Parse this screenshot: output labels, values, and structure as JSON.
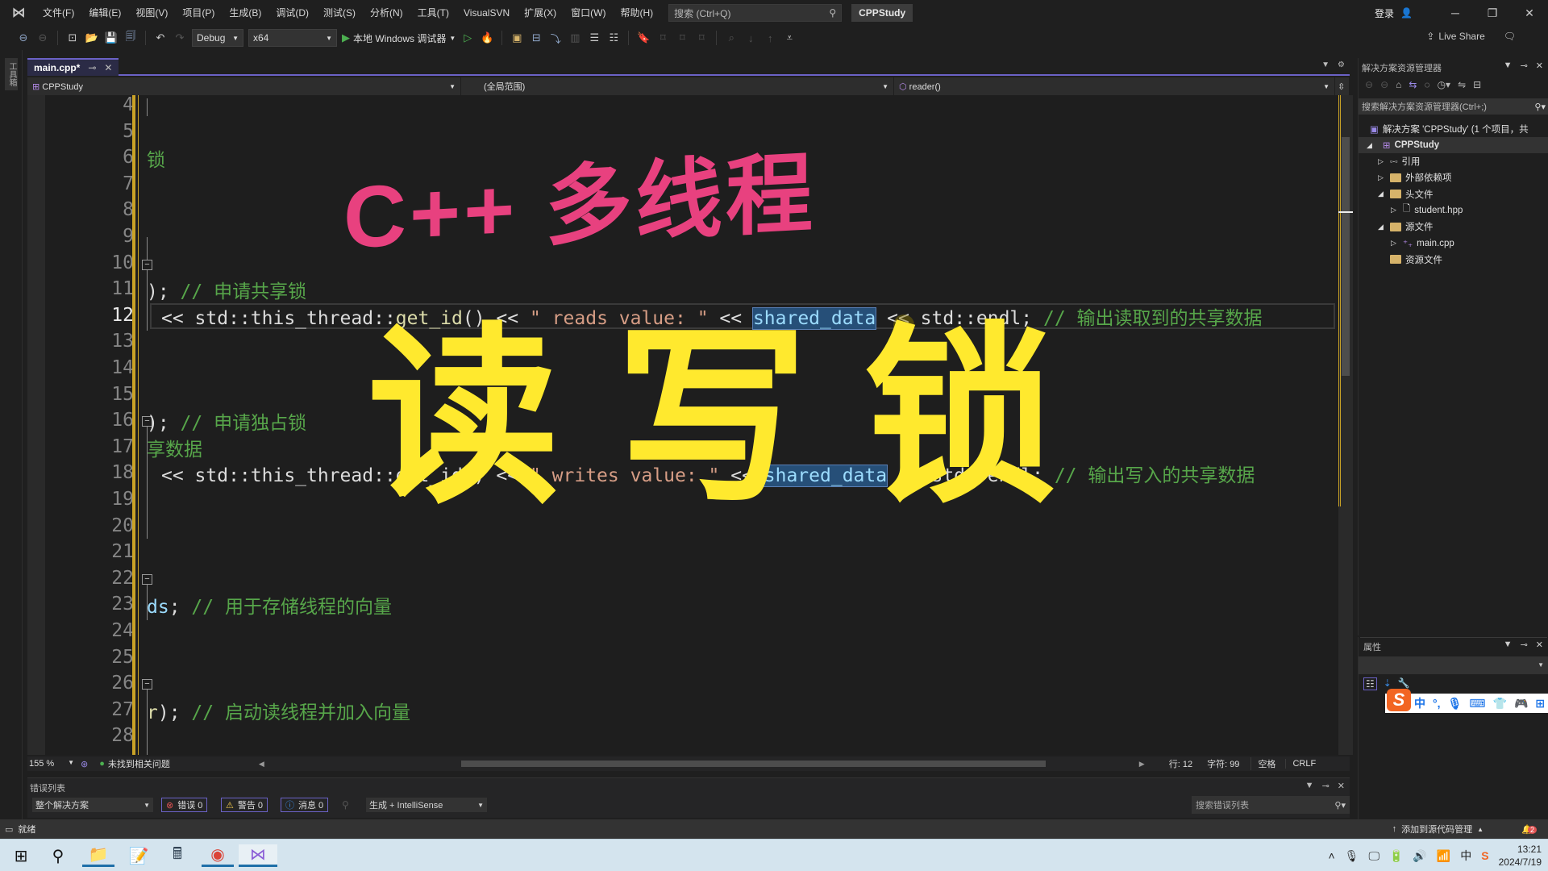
{
  "menubar": {
    "items": [
      "文件(F)",
      "编辑(E)",
      "视图(V)",
      "项目(P)",
      "生成(B)",
      "调试(D)",
      "测试(S)",
      "分析(N)",
      "工具(T)",
      "VisualSVN",
      "扩展(X)",
      "窗口(W)",
      "帮助(H)"
    ],
    "search_placeholder": "搜索 (Ctrl+Q)",
    "solution_name": "CPPStudy",
    "login": "登录"
  },
  "toolbar": {
    "config": "Debug",
    "platform": "x64",
    "run_label": "本地 Windows 调试器",
    "live_share": "Live Share"
  },
  "toolbox": {
    "label": "工具箱"
  },
  "editor": {
    "tab_label": "main.cpp*",
    "nav_project": "CPPStudy",
    "nav_scope": "(全局范围)",
    "nav_member": "reader()",
    "current_line": 12,
    "line_numbers": [
      4,
      5,
      6,
      7,
      8,
      9,
      10,
      11,
      12,
      13,
      14,
      15,
      16,
      17,
      18,
      19,
      20,
      21,
      22,
      23,
      24,
      25,
      26,
      27,
      28
    ],
    "code": {
      "l6": "锁",
      "l11_code": "); ",
      "l11_comment": "// 申请共享锁",
      "l12_a": "<< std::this_thread::",
      "l12_fn": "get_id",
      "l12_b": "() << ",
      "l12_str": "\" reads value: \"",
      "l12_c": " << ",
      "l12_sel": "shared_data",
      "l12_d": " << std::endl; ",
      "l12_comment": "// 输出读取到的共享数据",
      "l17_code": "); ",
      "l17_comment": "// 申请独占锁",
      "l18_comment": "享数据",
      "l19_a": "<< std::this_thread::get_id() << ",
      "l19_str": "\" writes value: \"",
      "l19_b": " << ",
      "l19_sel": "shared_data",
      "l19_c": " << std::endl; ",
      "l19_comment": "// 输出写入的共享数据",
      "l23_var": "ds",
      "l23_code": "; ",
      "l23_comment": "// 用于存储线程的向量",
      "l27_var": "r",
      "l27_code": "); ",
      "l27_comment": "// 启动读线程并加入向量"
    },
    "overlay_title": "C++ 多线程",
    "overlay_main": "读写锁",
    "zoom": "155 %",
    "issues": "未找到相关问题",
    "row": "行: 12",
    "col": "字符: 99",
    "indent": "空格",
    "eol": "CRLF"
  },
  "error_list": {
    "title": "错误列表",
    "scope": "整个解决方案",
    "errors": "错误 0",
    "warnings": "警告 0",
    "messages": "消息 0",
    "source": "生成 + IntelliSense",
    "search_placeholder": "搜索错误列表"
  },
  "status_bar": {
    "ready": "就绪",
    "source_control": "添加到源代码管理",
    "notifications": "2"
  },
  "solution_explorer": {
    "title": "解决方案资源管理器",
    "search_placeholder": "搜索解决方案资源管理器(Ctrl+;)",
    "solution": "解决方案 'CPPStudy' (1 个项目，共",
    "project": "CPPStudy",
    "items": [
      {
        "label": "引用",
        "indent": 1,
        "expander": "collapsed"
      },
      {
        "label": "外部依赖项",
        "indent": 1,
        "expander": "collapsed"
      },
      {
        "label": "头文件",
        "indent": 1,
        "expander": "expanded"
      },
      {
        "label": "student.hpp",
        "indent": 2,
        "expander": "collapsed"
      },
      {
        "label": "源文件",
        "indent": 1,
        "expander": "expanded"
      },
      {
        "label": "main.cpp",
        "indent": 2,
        "expander": "collapsed"
      },
      {
        "label": "资源文件",
        "indent": 1,
        "expander": "none"
      }
    ]
  },
  "properties": {
    "title": "属性"
  },
  "ime": {
    "mode": "中"
  },
  "taskbar": {
    "time": "13:21",
    "date": "2024/7/19",
    "ime_indicator": "中"
  },
  "colors": {
    "accent": "#6b62c6",
    "overlay_pink": "#e8417f",
    "overlay_yellow": "#ffe92e",
    "selection": "#264f78"
  }
}
